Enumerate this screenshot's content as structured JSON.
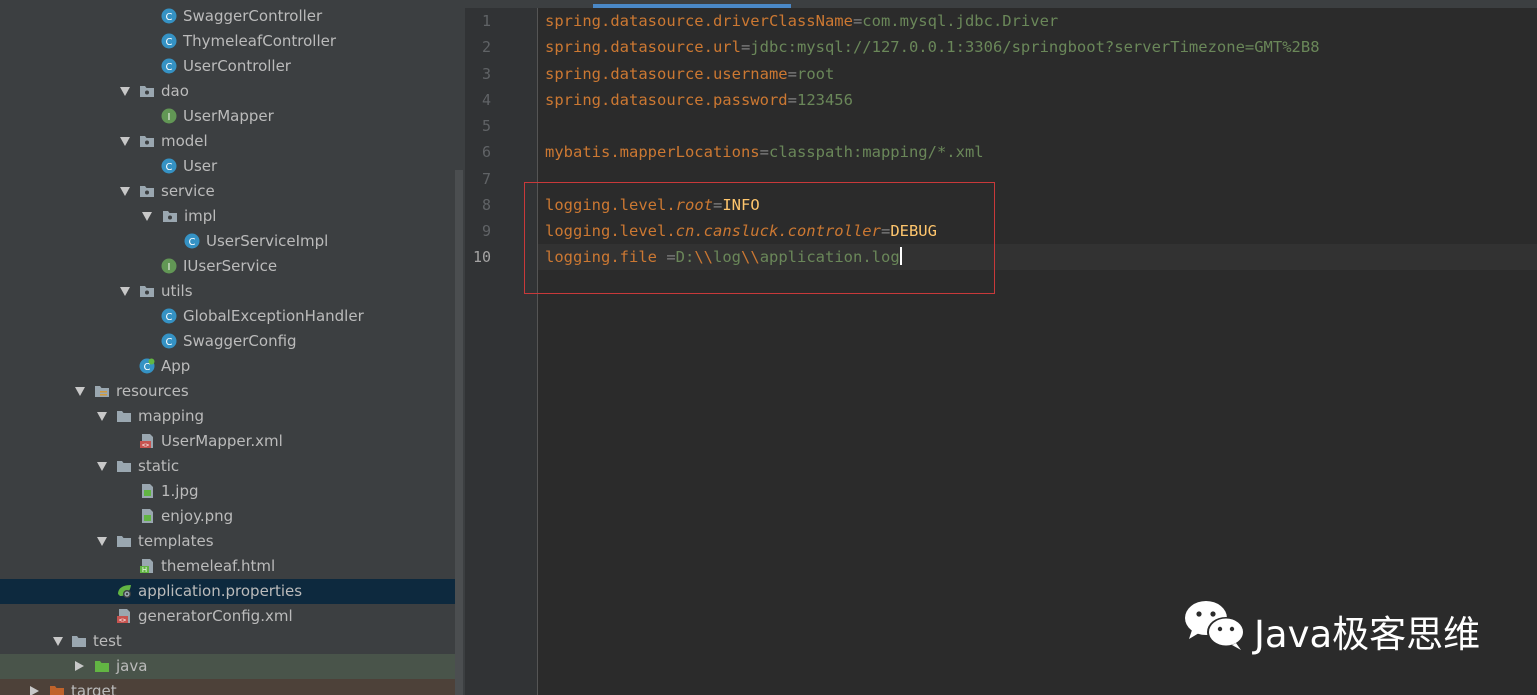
{
  "project_tree": {
    "rows": [
      {
        "label": "SwaggerController",
        "icon": "java-class-icon",
        "expand": "none"
      },
      {
        "label": "ThymeleafController",
        "icon": "java-class-icon",
        "expand": "none"
      },
      {
        "label": "UserController",
        "icon": "java-class-icon",
        "expand": "none"
      },
      {
        "label": "dao",
        "icon": "package-folder-icon",
        "expand": "expanded"
      },
      {
        "label": "UserMapper",
        "icon": "java-interface-icon",
        "expand": "none"
      },
      {
        "label": "model",
        "icon": "package-folder-icon",
        "expand": "expanded"
      },
      {
        "label": "User",
        "icon": "java-class-icon",
        "expand": "none"
      },
      {
        "label": "service",
        "icon": "package-folder-icon",
        "expand": "expanded"
      },
      {
        "label": "impl",
        "icon": "package-folder-icon",
        "expand": "expanded"
      },
      {
        "label": "UserServiceImpl",
        "icon": "java-class-icon",
        "expand": "none"
      },
      {
        "label": "IUserService",
        "icon": "java-interface-icon",
        "expand": "none"
      },
      {
        "label": "utils",
        "icon": "package-folder-icon",
        "expand": "expanded"
      },
      {
        "label": "GlobalExceptionHandler",
        "icon": "java-class-icon",
        "expand": "none"
      },
      {
        "label": "SwaggerConfig",
        "icon": "java-class-icon",
        "expand": "none"
      },
      {
        "label": "App",
        "icon": "spring-boot-app-icon",
        "expand": "none"
      },
      {
        "label": "resources",
        "icon": "resources-folder-icon",
        "expand": "expanded"
      },
      {
        "label": "mapping",
        "icon": "folder-icon",
        "expand": "expanded"
      },
      {
        "label": "UserMapper.xml",
        "icon": "xml-file-icon",
        "expand": "none"
      },
      {
        "label": "static",
        "icon": "folder-icon",
        "expand": "expanded"
      },
      {
        "label": "1.jpg",
        "icon": "image-file-icon",
        "expand": "none"
      },
      {
        "label": "enjoy.png",
        "icon": "image-file-icon",
        "expand": "none"
      },
      {
        "label": "templates",
        "icon": "folder-icon",
        "expand": "expanded"
      },
      {
        "label": "themeleaf.html",
        "icon": "html-file-icon",
        "expand": "none"
      },
      {
        "label": "application.properties",
        "icon": "spring-properties-icon",
        "expand": "none"
      },
      {
        "label": "generatorConfig.xml",
        "icon": "xml-file-icon",
        "expand": "none"
      },
      {
        "label": "test",
        "icon": "folder-icon",
        "expand": "expanded"
      },
      {
        "label": "java",
        "icon": "green-source-folder-icon",
        "expand": "collapsed"
      },
      {
        "label": "target",
        "icon": "orange-folder-icon",
        "expand": "collapsed"
      }
    ],
    "selected_label": "application.properties"
  },
  "editor": {
    "line_numbers": [
      "1",
      "2",
      "3",
      "4",
      "5",
      "6",
      "7",
      "8",
      "9",
      "10"
    ],
    "current_line": "10",
    "lines": [
      {
        "n": 1,
        "key": "spring.datasource.driverClassName",
        "eq": "=",
        "value": "com.mysql.jdbc.Driver"
      },
      {
        "n": 2,
        "key": "spring.datasource.url",
        "eq": "=",
        "value": "jdbc:mysql://127.0.0.1:3306/springboot?serverTimezone=GMT%2B8"
      },
      {
        "n": 3,
        "key": "spring.datasource.username",
        "eq": "=",
        "value": "root"
      },
      {
        "n": 4,
        "key": "spring.datasource.password",
        "eq": "=",
        "value": "123456"
      },
      {
        "n": 6,
        "key": "mybatis.mapperLocations",
        "eq": "=",
        "value": "classpath:mapping/*.xml"
      },
      {
        "n": 8,
        "key_prefix": "logging.level.",
        "key_italic": "root",
        "eq": "=",
        "level": "INFO"
      },
      {
        "n": 9,
        "key_prefix": "logging.level.",
        "key_italic": "cn.cansluck.controller",
        "eq": "=",
        "level": "DEBUG"
      },
      {
        "n": 10,
        "key": "logging.file ",
        "eq": "=",
        "value_parts": [
          "D:",
          "\\\\",
          "log",
          "\\\\",
          "application.log"
        ]
      }
    ]
  },
  "watermark": {
    "text": "Java极客思维",
    "icon": "wechat-icon"
  },
  "colors": {
    "key": "#cc7832",
    "value": "#6a8759",
    "log_level": "#ffc66d",
    "highlight_box": "#c8393a",
    "selection": "#0d293e"
  }
}
